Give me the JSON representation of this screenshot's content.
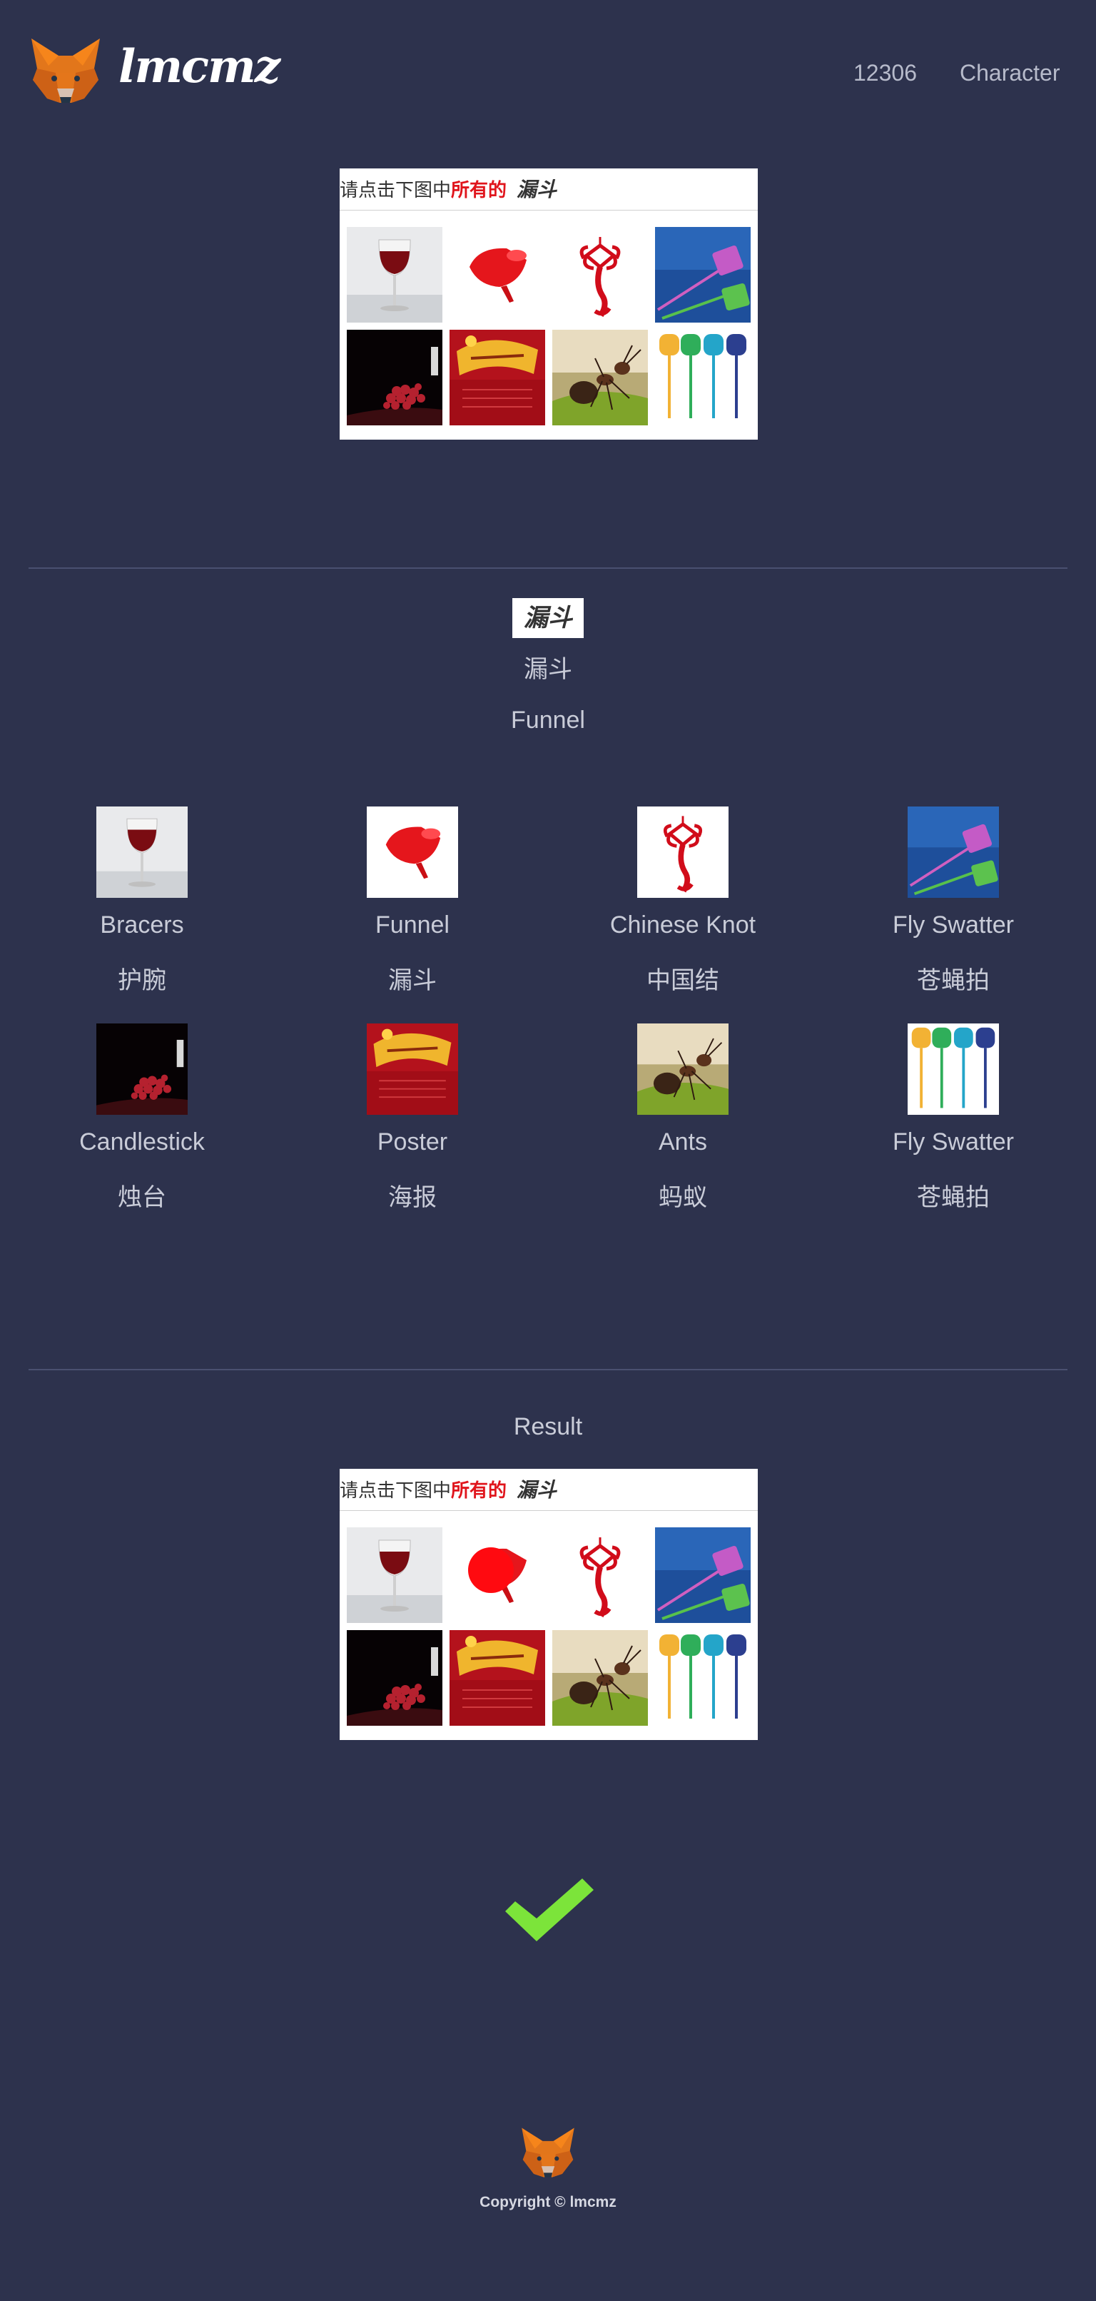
{
  "header": {
    "brand": "lmcmz",
    "nav": [
      "12306",
      "Character"
    ]
  },
  "captcha": {
    "prompt_prefix": "请点击下图中",
    "prompt_highlight": "所有的",
    "prompt_word": "漏斗"
  },
  "detected": {
    "word_cn": "漏斗",
    "word_en": "Funnel"
  },
  "tiles": [
    {
      "en": "Bracers",
      "cn": "护腕",
      "icon": "wine-glass-image"
    },
    {
      "en": "Funnel",
      "cn": "漏斗",
      "icon": "funnel-image"
    },
    {
      "en": "Chinese Knot",
      "cn": "中国结",
      "icon": "chinese-knot-image"
    },
    {
      "en": "Fly Swatter",
      "cn": "苍蝇拍",
      "icon": "fly-swatter-image"
    },
    {
      "en": "Candlestick",
      "cn": "烛台",
      "icon": "grapes-image"
    },
    {
      "en": "Poster",
      "cn": "海报",
      "icon": "poster-image"
    },
    {
      "en": "Ants",
      "cn": "蚂蚁",
      "icon": "ant-image"
    },
    {
      "en": "Fly Swatter",
      "cn": "苍蝇拍",
      "icon": "fly-swatters-image"
    }
  ],
  "result": {
    "title": "Result",
    "status_icon": "checkmark-icon",
    "status_color": "#7ce43a"
  },
  "footer": {
    "copyright": "Copyright © lmcmz"
  },
  "colors": {
    "background": "#2d324d",
    "text": "#c9ccd8",
    "accent_red": "#e0151c"
  }
}
